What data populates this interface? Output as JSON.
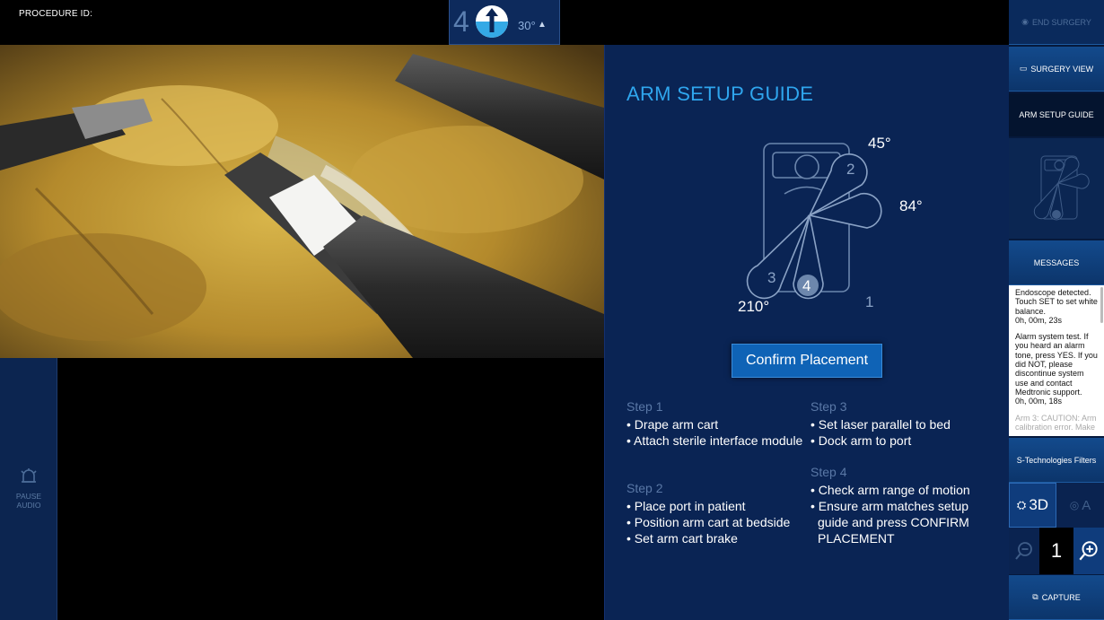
{
  "header": {
    "procedure_id_label": "PROCEDURE ID:",
    "endoscope_arm": "4",
    "scope_angle": "30°",
    "angle_caret": "▲"
  },
  "left_panel": {
    "pause_audio_label": "PAUSE\nAUDIO"
  },
  "guide": {
    "title": "ARM SETUP GUIDE",
    "arms": [
      {
        "number": "1",
        "angle": "84°"
      },
      {
        "number": "2",
        "angle": "45°"
      },
      {
        "number": "3",
        "angle": "210°"
      },
      {
        "number": "4",
        "angle": ""
      }
    ],
    "confirm_label": "Confirm Placement",
    "steps": [
      {
        "title": "Step 1",
        "items": [
          "Drape arm cart",
          "Attach sterile interface module"
        ]
      },
      {
        "title": "Step 2",
        "items": [
          "Place port in patient",
          "Position arm cart at bedside",
          "Set arm cart brake"
        ]
      },
      {
        "title": "Step 3",
        "items": [
          "Set laser parallel to bed",
          "Dock arm to port"
        ]
      },
      {
        "title": "Step 4",
        "items": [
          "Check arm range of motion",
          "Ensure arm matches setup guide and press CONFIRM PLACEMENT"
        ]
      }
    ]
  },
  "sidebar": {
    "end_surgery": "END SURGERY",
    "surgery_view": "SURGERY VIEW",
    "arm_setup_guide": "ARM SETUP GUIDE",
    "messages_label": "MESSAGES",
    "messages": [
      "Endoscope detected. Touch SET to set white balance.\n0h, 00m, 23s",
      "Alarm system test. If you heard an alarm tone, press YES.  If you did NOT, please discontinue system use and contact Medtronic support.\n0h, 00m, 18s",
      "Arm 3: CAUTION: Arm calibration error. Make"
    ],
    "filters_label": "S-Technologies Filters",
    "mode_3d": "3D",
    "mode_a": "A",
    "zoom_value": "1",
    "capture_label": "CAPTURE"
  },
  "colors": {
    "accent": "#2fa6ee",
    "panel": "#0a2454",
    "button": "#0f63b6"
  }
}
